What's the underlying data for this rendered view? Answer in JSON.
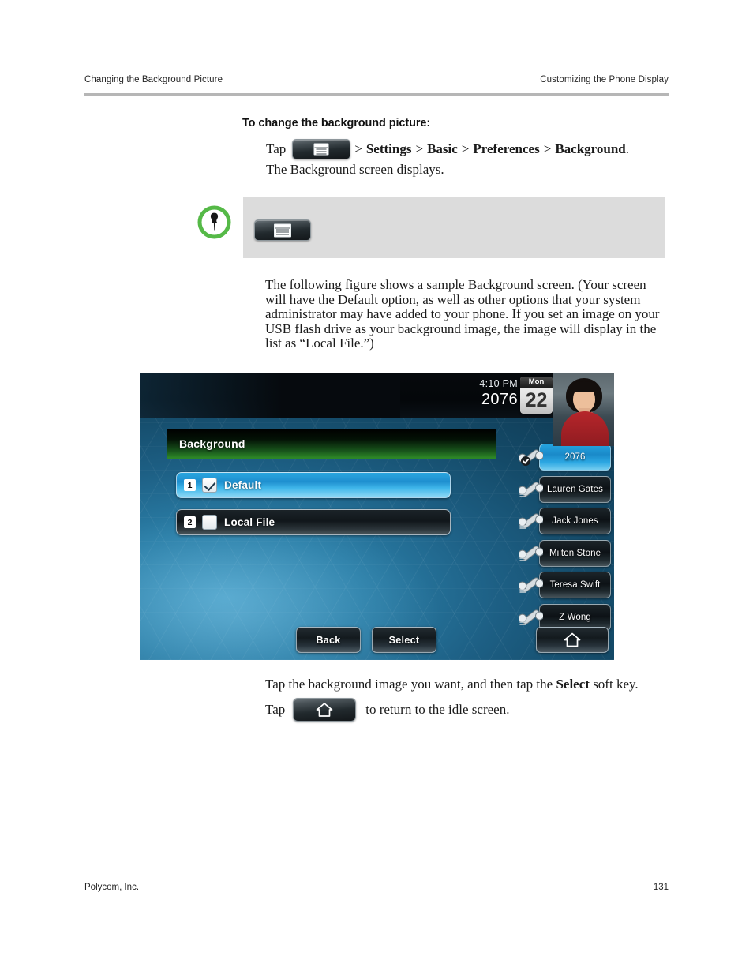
{
  "header": {
    "left": "Changing the Background Picture",
    "right": "Customizing the Phone Display"
  },
  "section": {
    "title": "To change the background picture:",
    "tap_word": "Tap",
    "menu_icon": "menu-key-icon",
    "breadcrumb": {
      "sep1": ">",
      "item1": "Settings",
      "sep2": ">",
      "item2": "Basic",
      "sep3": ">",
      "item3": "Preferences",
      "sep4": ">",
      "item4": "Background",
      "period": "."
    },
    "result_line": "The Background screen displays."
  },
  "note": {
    "icon": "pushpin-icon",
    "key_icon": "menu-key-icon",
    "background_color": "#dcdcdc",
    "accent_color": "#55b947"
  },
  "paragraph": "The following figure shows a sample Background screen. (Your screen will have the Default option, as well as other options that your system administrator may have added to your phone. If you set an image on your USB flash drive as your background image, the image will display in the list as “Local File.”)",
  "phone_screen": {
    "status": {
      "time": "4:10 PM",
      "extension": "2076",
      "calendar_weekday": "Mon",
      "calendar_day": "22",
      "avatar": "user-photo"
    },
    "title_bar": {
      "label": "Background",
      "color": "#2f8a28"
    },
    "options": [
      {
        "index": "1",
        "label": "Default",
        "checked": true,
        "selected": true
      },
      {
        "index": "2",
        "label": "Local File",
        "checked": false,
        "selected": false
      }
    ],
    "line_keys": [
      {
        "label": "2076",
        "active": true,
        "icon": "handset-registered-icon"
      },
      {
        "label": "Lauren Gates",
        "active": false,
        "icon": "handset-icon"
      },
      {
        "label": "Jack Jones",
        "active": false,
        "icon": "handset-icon"
      },
      {
        "label": "Milton Stone",
        "active": false,
        "icon": "handset-icon"
      },
      {
        "label": "Teresa Swift",
        "active": false,
        "icon": "handset-icon"
      },
      {
        "label": "Z Wong",
        "active": false,
        "icon": "handset-icon"
      }
    ],
    "soft_keys": [
      {
        "label": "Back"
      },
      {
        "label": "Select"
      }
    ],
    "home_key_icon": "home-icon"
  },
  "closing": {
    "line1_part1": "Tap the background image you want, and then tap the ",
    "line1_bold": "Select",
    "line1_part2": " soft key.",
    "line2_tap": "Tap",
    "line2_icon": "home-key-icon",
    "line2_rest": "to return to the idle screen."
  },
  "footer": {
    "left": "Polycom, Inc.",
    "right": "131"
  }
}
